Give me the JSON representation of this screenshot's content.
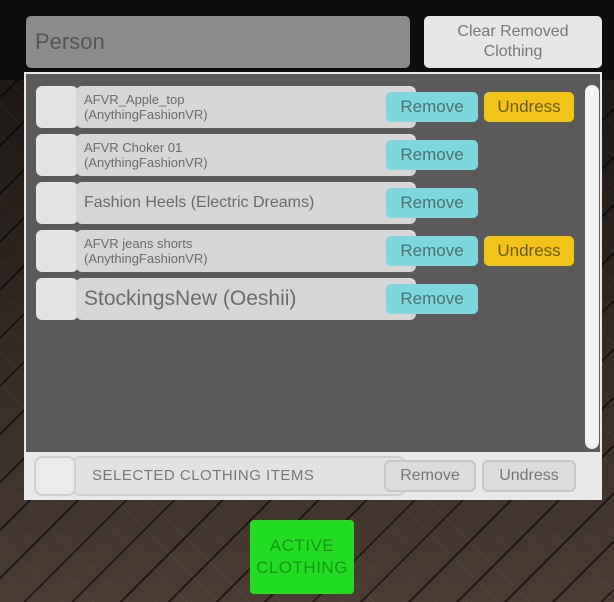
{
  "header": {
    "title": "Person",
    "clear_button": "Clear Removed\nClothing"
  },
  "clothing_items": [
    {
      "label": "AFVR_Apple_top\n(AnythingFashionVR)",
      "remove": "Remove",
      "undress": "Undress"
    },
    {
      "label": "AFVR Choker 01\n(AnythingFashionVR)",
      "remove": "Remove"
    },
    {
      "label": "Fashion Heels (Electric Dreams)",
      "remove": "Remove"
    },
    {
      "label": "AFVR jeans shorts\n(AnythingFashionVR)",
      "remove": "Remove",
      "undress": "Undress"
    },
    {
      "label": "StockingsNew (Oeshii)",
      "remove": "Remove"
    }
  ],
  "footer": {
    "selected_label": "SELECTED CLOTHING ITEMS",
    "remove": "Remove",
    "undress": "Undress"
  },
  "active_clothing_button": "ACTIVE\nCLOTHING",
  "colors": {
    "remove_button": "#7fd7de",
    "undress_button": "#f0c419",
    "active_button": "#22dd22"
  }
}
